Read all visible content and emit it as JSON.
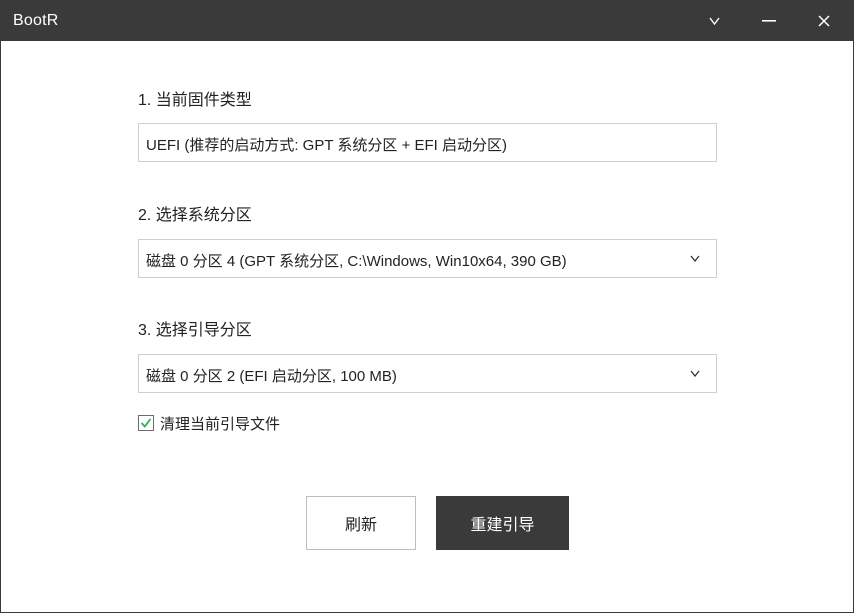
{
  "window": {
    "title": "BootR"
  },
  "titlebar_buttons": {
    "collapse": "collapse-icon",
    "minimize": "minimize-icon",
    "close": "close-icon"
  },
  "firmware": {
    "label": "1. 当前固件类型",
    "value": "UEFI  (推荐的启动方式: GPT 系统分区 + EFI 启动分区)"
  },
  "system_partition": {
    "label": "2. 选择系统分区",
    "selected": "磁盘 0 分区 4  (GPT 系统分区, C:\\Windows, Win10x64, 390 GB)"
  },
  "boot_partition": {
    "label": "3. 选择引导分区",
    "selected": "磁盘 0 分区 2  (EFI 启动分区, 100 MB)"
  },
  "options": {
    "clean_boot_label": "清理当前引导文件",
    "clean_boot_checked": true
  },
  "buttons": {
    "refresh": "刷新",
    "rebuild": "重建引导"
  },
  "colors": {
    "titlebar": "#3a3a3a",
    "primary_button": "#3a3a3a",
    "check_accent": "#2fae5a"
  }
}
